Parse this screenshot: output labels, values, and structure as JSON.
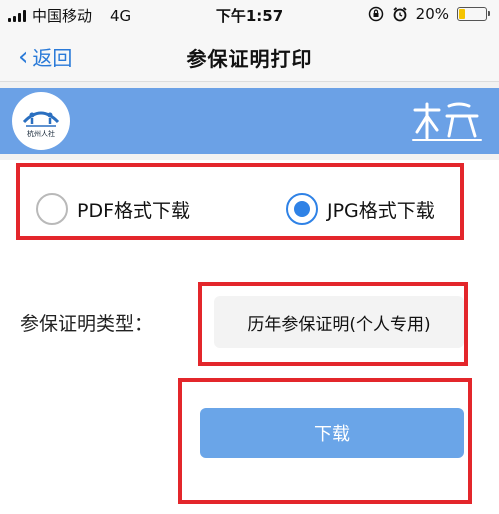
{
  "status_bar": {
    "carrier": "中国移动",
    "network": "4G",
    "time": "下午1:57",
    "battery": "20%",
    "battery_level": 0.2,
    "icons": [
      "signal-icon",
      "rotation-lock-icon",
      "alarm-icon",
      "battery-icon"
    ]
  },
  "nav": {
    "back_label": "返回",
    "title": "参保证明打印"
  },
  "banner": {
    "logo_text": "杭州人社",
    "accent_color": "#6ba1e6"
  },
  "format": {
    "options": [
      {
        "label": "PDF格式下载",
        "selected": false
      },
      {
        "label": "JPG格式下载",
        "selected": true
      }
    ]
  },
  "proof_type": {
    "label": "参保证明类型：",
    "value": "历年参保证明(个人专用)"
  },
  "download": {
    "label": "下载",
    "color": "#6aa5e8"
  },
  "highlight_color": "#e3262b"
}
